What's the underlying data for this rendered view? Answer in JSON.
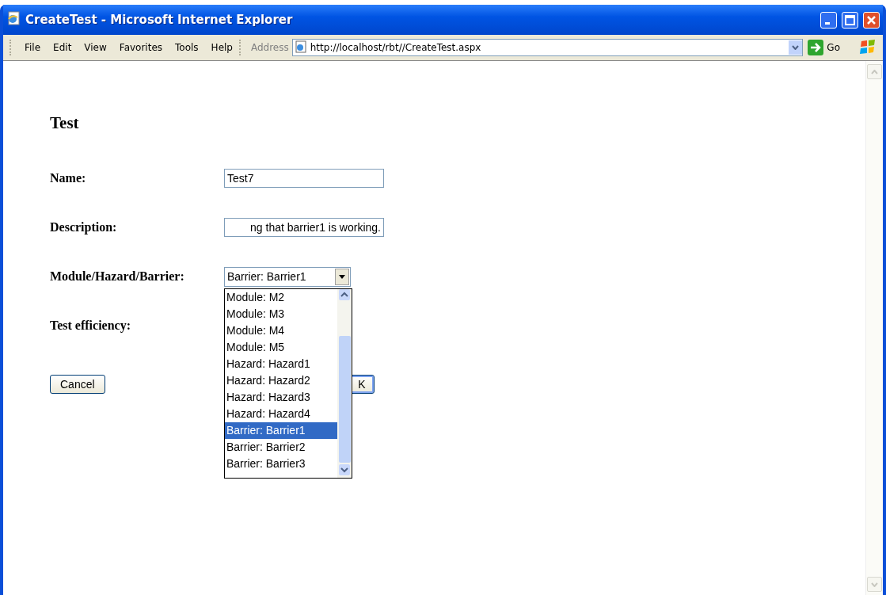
{
  "window": {
    "title": "CreateTest - Microsoft Internet Explorer"
  },
  "menu": [
    "File",
    "Edit",
    "View",
    "Favorites",
    "Tools",
    "Help"
  ],
  "address": {
    "label": "Address",
    "value": "http://localhost/rbt//CreateTest.aspx",
    "go": "Go"
  },
  "page": {
    "heading": "Test",
    "fields": [
      {
        "label": "Name:",
        "kind": "text",
        "value": "Test7"
      },
      {
        "label": "Description:",
        "kind": "text",
        "value": "ng that barrier1 is working."
      },
      {
        "label": "Module/Hazard/Barrier:",
        "kind": "select",
        "value": "Barrier: Barrier1",
        "expanded": true,
        "options": [
          {
            "label": "Module: M2",
            "selected": false
          },
          {
            "label": "Module: M3",
            "selected": false
          },
          {
            "label": "Module: M4",
            "selected": false
          },
          {
            "label": "Module: M5",
            "selected": false
          },
          {
            "label": "Hazard: Hazard1",
            "selected": false
          },
          {
            "label": "Hazard: Hazard2",
            "selected": false
          },
          {
            "label": "Hazard: Hazard3",
            "selected": false
          },
          {
            "label": "Hazard: Hazard4",
            "selected": false
          },
          {
            "label": "Barrier: Barrier1",
            "selected": true
          },
          {
            "label": "Barrier: Barrier2",
            "selected": false
          },
          {
            "label": "Barrier: Barrier3",
            "selected": false
          }
        ]
      },
      {
        "label": "Test efficiency:",
        "kind": "hidden"
      }
    ],
    "buttons": [
      "Cancel",
      "K"
    ]
  }
}
